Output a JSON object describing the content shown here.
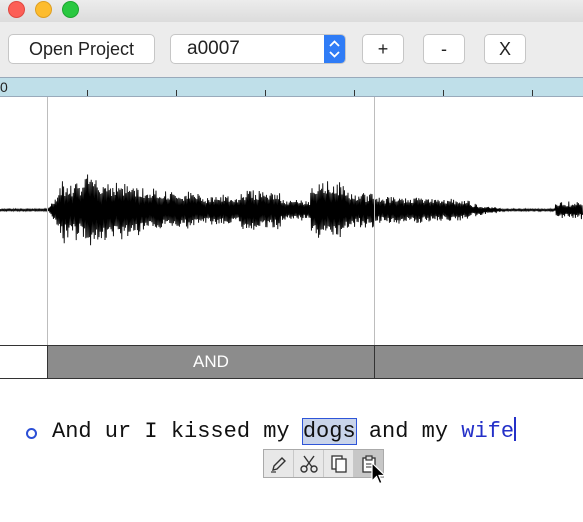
{
  "toolbar": {
    "open_project_label": "Open Project",
    "project_select_value": "a0007",
    "add_label": "+",
    "remove_label": "-",
    "close_label": "X"
  },
  "timeline": {
    "ruler_start_label": "0"
  },
  "segments": [
    {
      "label": ""
    },
    {
      "label": "AND"
    },
    {
      "label": ""
    }
  ],
  "transcript": {
    "text_before": "And ur I kissed my ",
    "selected_word": "dogs",
    "text_middle": " and my ",
    "highlighted_word": "wife"
  },
  "edit_popup": {
    "icons": [
      "pencil-icon",
      "scissors-icon",
      "copy-icon",
      "paste-icon"
    ]
  },
  "colors": {
    "accent": "#2f7cf6",
    "ruler": "#bfdfe9",
    "segment": "#8c8c8c",
    "word_highlight": "#2430c8"
  }
}
